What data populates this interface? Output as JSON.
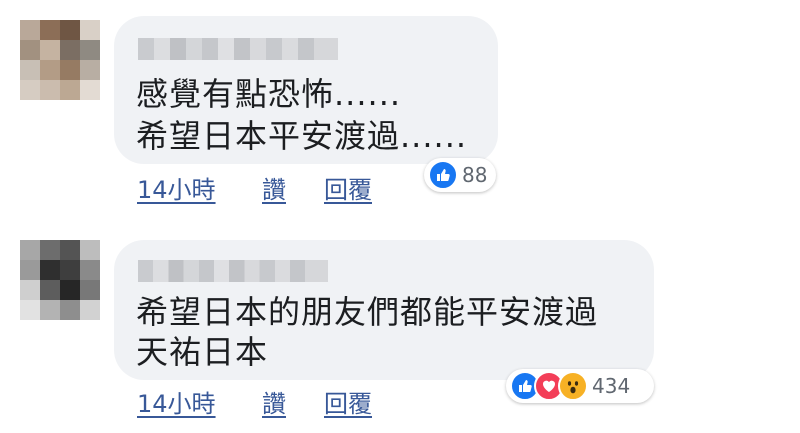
{
  "comments": [
    {
      "lines": [
        "感覺有點恐怖......",
        "希望日本平安渡過......"
      ],
      "actions": {
        "time": "14小時",
        "like": "讚",
        "reply": "回覆"
      },
      "reactions": {
        "icons": [
          "like-icon"
        ],
        "count": "88"
      }
    },
    {
      "lines": [
        "希望日本的朋友們都能平安渡過",
        "天祐日本"
      ],
      "actions": {
        "time": "14小時",
        "like": "讚",
        "reply": "回覆"
      },
      "reactions": {
        "icons": [
          "like-icon",
          "love-icon",
          "wow-icon"
        ],
        "count": "434"
      }
    }
  ],
  "colors": {
    "bubble": "#f0f2f5",
    "link": "#385898",
    "like": "#1877f2",
    "love": "#f33e58",
    "wow": "#f7b125"
  }
}
